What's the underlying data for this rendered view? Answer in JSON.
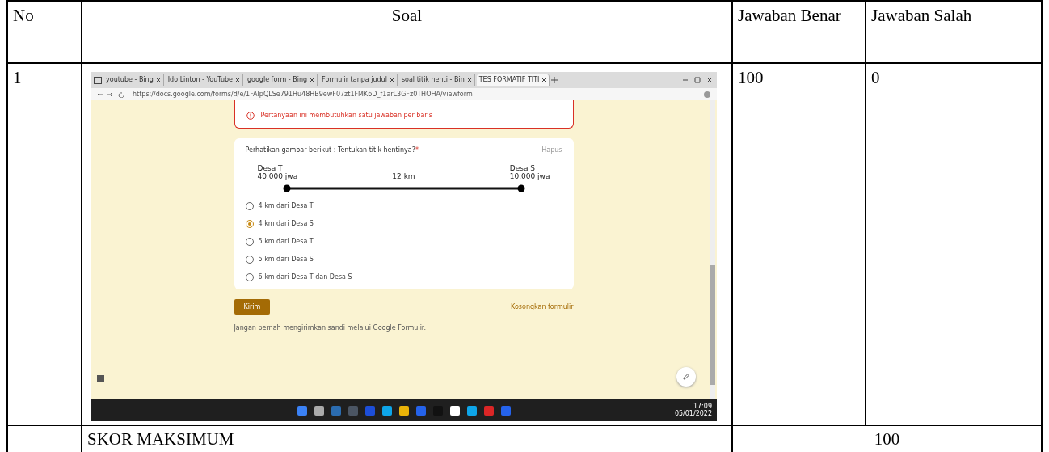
{
  "table": {
    "columns": [
      "No",
      "Soal",
      "Jawaban Benar",
      "Jawaban Salah"
    ],
    "rows": [
      {
        "no": "1",
        "correct": "100",
        "wrong": "0"
      }
    ],
    "footer": {
      "label": "SKOR MAKSIMUM",
      "score": "100"
    }
  },
  "screenshot": {
    "tabs": [
      {
        "title": "youtube - Bing",
        "selected": false
      },
      {
        "title": "Ido Linton - YouTube",
        "selected": false
      },
      {
        "title": "google form - Bing",
        "selected": false
      },
      {
        "title": "Formulir tanpa judul",
        "selected": false
      },
      {
        "title": "soal titik henti - Bin",
        "selected": false
      },
      {
        "title": "TES FORMATIF TITI",
        "selected": true
      }
    ],
    "url": "https://docs.google.com/forms/d/e/1FAIpQLSe791Hu48HB9ewF07zt1FMK6D_f1arL3GFz0THOHA/viewform",
    "error": "Pertanyaan ini membutuhkan satu jawaban per baris",
    "question": "Perhatikan gambar berikut : Tentukan titik hentinya?",
    "required_mark": "*",
    "clear": "Hapus",
    "figure": {
      "left_name": "Desa T",
      "left_pop": "40.000 jwa",
      "distance": "12 km",
      "right_name": "Desa S",
      "right_pop": "10.000 jwa"
    },
    "options": [
      {
        "label": "4 km dari Desa T",
        "selected": false
      },
      {
        "label": "4 km dari Desa S",
        "selected": true
      },
      {
        "label": "5 km dari Desa T",
        "selected": false
      },
      {
        "label": "5 km dari Desa S",
        "selected": false
      },
      {
        "label": "6 km dari Desa T dan Desa S",
        "selected": false
      }
    ],
    "submit": "Kirim",
    "reset": "Kosongkan formulir",
    "footer": "Jangan pernah mengirimkan sandi melalui Google Formulir.",
    "clock": {
      "time": "17:09",
      "date": "05/01/2022"
    }
  }
}
